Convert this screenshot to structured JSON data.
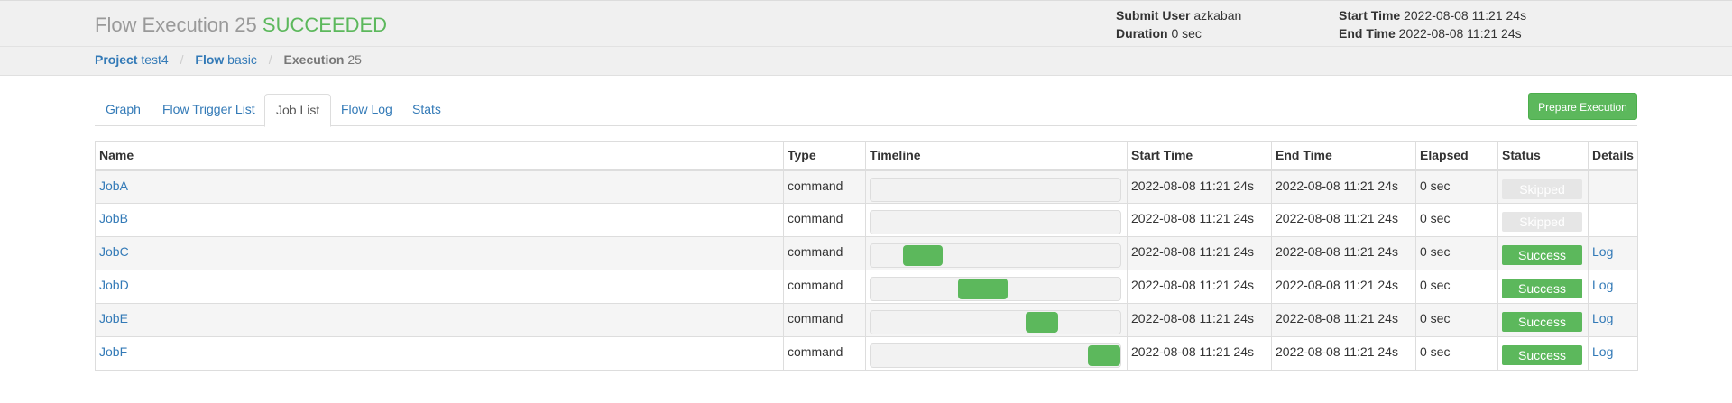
{
  "header": {
    "title": "Flow Execution 25",
    "status": "SUCCEEDED",
    "submit_user_label": "Submit User",
    "submit_user": "azkaban",
    "duration_label": "Duration",
    "duration": "0 sec",
    "start_time_label": "Start Time",
    "start_time": "2022-08-08 11:21 24s",
    "end_time_label": "End Time",
    "end_time": "2022-08-08 11:21 24s"
  },
  "breadcrumb": {
    "project_label": "Project",
    "project": "test4",
    "flow_label": "Flow",
    "flow": "basic",
    "execution_label": "Execution",
    "execution": "25"
  },
  "tabs": [
    "Graph",
    "Flow Trigger List",
    "Job List",
    "Flow Log",
    "Stats"
  ],
  "active_tab": "Job List",
  "prepare_button": "Prepare Execution",
  "table": {
    "headers": [
      "Name",
      "Type",
      "Timeline",
      "Start Time",
      "End Time",
      "Elapsed",
      "Status",
      "Details"
    ],
    "rows": [
      {
        "name": "JobA",
        "type": "command",
        "timeline": null,
        "start": "2022-08-08 11:21 24s",
        "end": "2022-08-08 11:21 24s",
        "elapsed": "0 sec",
        "status": "Skipped",
        "details": ""
      },
      {
        "name": "JobB",
        "type": "command",
        "timeline": null,
        "start": "2022-08-08 11:21 24s",
        "end": "2022-08-08 11:21 24s",
        "elapsed": "0 sec",
        "status": "Skipped",
        "details": ""
      },
      {
        "name": "JobC",
        "type": "command",
        "timeline": {
          "start_fraction": 0.13,
          "end_fraction": 0.29
        },
        "start": "2022-08-08 11:21 24s",
        "end": "2022-08-08 11:21 24s",
        "elapsed": "0 sec",
        "status": "Success",
        "details": "Log"
      },
      {
        "name": "JobD",
        "type": "command",
        "timeline": {
          "start_fraction": 0.35,
          "end_fraction": 0.55
        },
        "start": "2022-08-08 11:21 24s",
        "end": "2022-08-08 11:21 24s",
        "elapsed": "0 sec",
        "status": "Success",
        "details": "Log"
      },
      {
        "name": "JobE",
        "type": "command",
        "timeline": {
          "start_fraction": 0.62,
          "end_fraction": 0.75
        },
        "start": "2022-08-08 11:21 24s",
        "end": "2022-08-08 11:21 24s",
        "elapsed": "0 sec",
        "status": "Success",
        "details": "Log"
      },
      {
        "name": "JobF",
        "type": "command",
        "timeline": {
          "start_fraction": 0.87,
          "end_fraction": 1.0
        },
        "start": "2022-08-08 11:21 24s",
        "end": "2022-08-08 11:21 24s",
        "elapsed": "0 sec",
        "status": "Success",
        "details": "Log"
      }
    ]
  },
  "colors": {
    "success": "#5cb85c",
    "skipped": "#e6e6e6",
    "link": "#337ab7",
    "title_grey": "#999999"
  }
}
